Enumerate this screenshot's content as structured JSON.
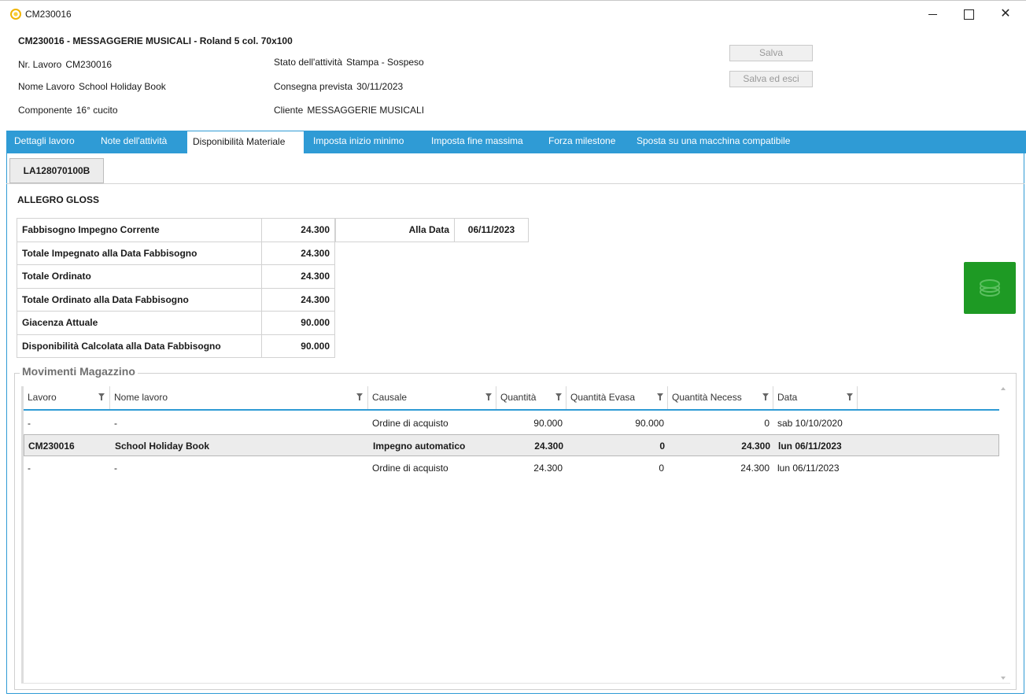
{
  "window": {
    "title": "CM230016",
    "close_glyph": "✕"
  },
  "header": {
    "job_title": "CM230016 - MESSAGGERIE MUSICALI - Roland 5 col. 70x100",
    "nr_lavoro_label": "Nr. Lavoro",
    "nr_lavoro_value": "CM230016",
    "nome_lavoro_label": "Nome Lavoro",
    "nome_lavoro_value": "School Holiday Book",
    "componente_label": "Componente",
    "componente_value": "16° cucito",
    "stato_label": "Stato dell'attività",
    "stato_value": "Stampa - Sospeso",
    "consegna_label": "Consegna prevista",
    "consegna_value": "30/11/2023",
    "cliente_label": "Cliente",
    "cliente_value": "MESSAGGERIE MUSICALI",
    "save_label": "Salva",
    "save_exit_label": "Salva ed esci"
  },
  "tabs": [
    {
      "label": "Dettagli lavoro"
    },
    {
      "label": "Note dell'attività"
    },
    {
      "label": "Disponibilità Materiale"
    },
    {
      "label": "Imposta inizio minimo"
    },
    {
      "label": "Imposta fine massima"
    },
    {
      "label": "Forza milestone"
    },
    {
      "label": "Sposta su una macchina compatibile"
    }
  ],
  "active_tab_index": 2,
  "material": {
    "code_tab": "LA128070100B",
    "name": "ALLEGRO GLOSS",
    "summary": [
      {
        "label": "Fabbisogno Impegno Corrente",
        "value": "24.300"
      },
      {
        "label": "Totale Impegnato alla Data Fabbisogno",
        "value": "24.300"
      },
      {
        "label": "Totale Ordinato",
        "value": "24.300"
      },
      {
        "label": "Totale Ordinato alla Data Fabbisogno",
        "value": "24.300"
      },
      {
        "label": "Giacenza Attuale",
        "value": "90.000"
      },
      {
        "label": "Disponibilità Calcolata alla Data Fabbisogno",
        "value": "90.000"
      }
    ],
    "alla_data_label": "Alla Data",
    "alla_data_value": "06/11/2023",
    "action_button_color": "#1e9a24"
  },
  "movements": {
    "group_title": "Movimenti Magazzino",
    "columns": [
      "Lavoro",
      "Nome lavoro",
      "Causale",
      "Quantità",
      "Quantità Evasa",
      "Quantità Necess",
      "Data"
    ],
    "rows": [
      {
        "lavoro": "-",
        "nome": "-",
        "causale": "Ordine di acquisto",
        "quantita": "90.000",
        "evasa": "90.000",
        "necess": "0",
        "data": "sab 10/10/2020"
      },
      {
        "lavoro": "CM230016",
        "nome": "School Holiday Book",
        "causale": "Impegno automatico",
        "quantita": "24.300",
        "evasa": "0",
        "necess": "24.300",
        "data": "lun 06/11/2023"
      },
      {
        "lavoro": "-",
        "nome": "-",
        "causale": "Ordine di acquisto",
        "quantita": "24.300",
        "evasa": "0",
        "necess": "24.300",
        "data": "lun 06/11/2023"
      }
    ],
    "selected_row_index": 1
  },
  "colors": {
    "accent": "#2f9bd5",
    "green_button": "#1e9a24"
  },
  "icons": {
    "app": "app-logo-icon",
    "action": "coins-stack-icon",
    "filter": "filter-funnel-icon"
  }
}
